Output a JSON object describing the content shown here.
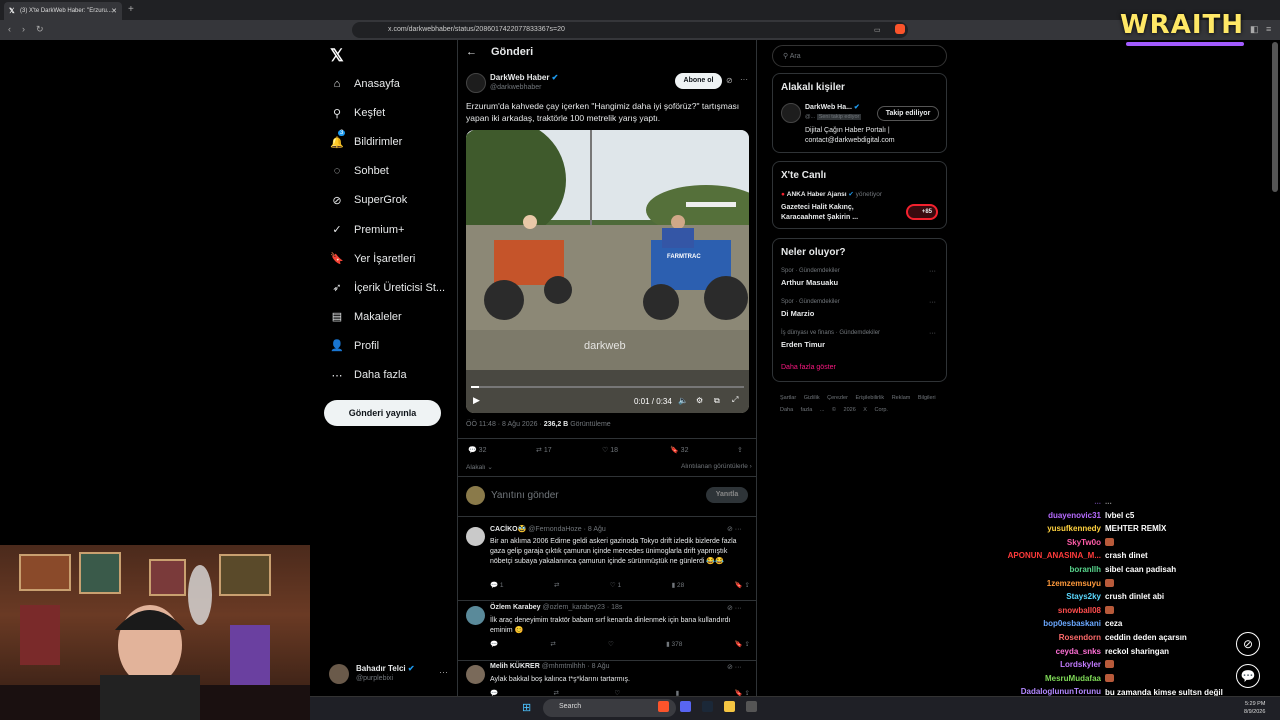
{
  "browser": {
    "tab_title": "(3) X'te DarkWeb Haber: \"Erzuru...",
    "url": "x.com/darkwebhaber/status/2086017422077833367s=20"
  },
  "overlay": {
    "watermark": "WRAITH"
  },
  "nav": {
    "items": [
      {
        "label": "Anasayfa",
        "icon": "home-icon"
      },
      {
        "label": "Keşfet",
        "icon": "search-icon"
      },
      {
        "label": "Bildirimler",
        "icon": "bell-icon",
        "badge": "3"
      },
      {
        "label": "Sohbet",
        "icon": "chat-icon"
      },
      {
        "label": "SuperGrok",
        "icon": "grok-icon"
      },
      {
        "label": "Premium+",
        "icon": "premium-icon"
      },
      {
        "label": "Yer İşaretleri",
        "icon": "bookmark-icon"
      },
      {
        "label": "İçerik Üreticisi St...",
        "icon": "rocket-icon"
      },
      {
        "label": "Makaleler",
        "icon": "article-icon"
      },
      {
        "label": "Profil",
        "icon": "person-icon"
      },
      {
        "label": "Daha fazla",
        "icon": "more-icon"
      }
    ],
    "post_button": "Gönderi yayınla",
    "user": {
      "name": "Bahadır Telci",
      "handle": "@purplebixi"
    }
  },
  "post": {
    "header": "Gönderi",
    "author": {
      "name": "DarkWeb Haber",
      "handle": "@darkwebhaber"
    },
    "subscribe": "Abone ol",
    "text": "Erzurum'da kahvede çay içerken \"Hangimiz daha iyi şoförüz?\" tartışması yapan iki arkadaş, traktörle 100 metrelik yarış yaptı.",
    "video": {
      "time": "0:01 / 0:34",
      "progress": 0.03,
      "watermark": "darkweb",
      "tractor_label": "FARMTRAC"
    },
    "meta": {
      "time": "ÖÖ 11:48 · 8 Ağu 2026 ·",
      "views": "236,2 B",
      "views_label": "Görüntüleme"
    },
    "actions": {
      "replies": "32",
      "reposts": "17",
      "likes": "18",
      "bookmarks": "32"
    },
    "relevant": "Alakalı",
    "engagements": "Alıntılanan görüntülerle",
    "reply_placeholder": "Yanıtını gönder",
    "reply_button": "Yanıtla"
  },
  "comments": [
    {
      "name": "CACİKO🥸",
      "handle": "@FernondaHoze · 8 Ağu",
      "text": "Bir an aklıma 2006 Edirne geldi askeri gazinoda Tokyo drift izledik bizlerde fazla gaza gelip garaja çıktık çamurun içinde  mercedes ünimoglarla drift yapmıştık nöbetçi subaya yakalanınca çamurun içinde sürünmüştük ne günlerdi 😂😂",
      "replies": "1",
      "reposts": "",
      "likes": "1",
      "views": "28",
      "avatar": "#c9c9c9"
    },
    {
      "name": "Özlem Karabey",
      "handle": "@ozlem_karabey23 · 18s",
      "text": "İlk araç deneyimim traktör babam sırf kenarda dinlenmek için bana kullandırdı eminim 😊",
      "replies": "",
      "reposts": "",
      "likes": "",
      "views": "378",
      "avatar": "#5a8a9a"
    },
    {
      "name": "Melih KÜKRER",
      "handle": "@mhmtmlhhh · 8 Ağu",
      "text": "Aylak bakkal boş kalınca t*ş*klarını tartarmış.",
      "replies": "",
      "reposts": "",
      "likes": "",
      "views": "",
      "avatar": "#7a6a5a"
    }
  ],
  "right": {
    "search_placeholder": "Ara",
    "relevant_title": "Alakalı kişiler",
    "relevant_person": {
      "name": "DarkWeb Ha...",
      "handle": "@...",
      "badge": "Seni takip ediyor",
      "follow": "Takip ediliyor",
      "bio": "Dijital Çağın Haber Portalı | contact@darkwebdigital.com"
    },
    "live_title": "X'te Canlı",
    "live": {
      "account": "ANKA Haber Ajansı",
      "role": "yönetiyor",
      "title": "Gazeteci Halit Kakınç, Karacaahmet Şakirin ...",
      "count": "+85"
    },
    "trends_title": "Neler oluyor?",
    "trends": [
      {
        "meta": "Spor · Gündemdekiler",
        "name": "Arthur Masuaku"
      },
      {
        "meta": "Spor · Gündemdekiler",
        "name": "Di Marzio"
      },
      {
        "meta": "İş dünyası ve finans · Gündemdekiler",
        "name": "Erden Timur"
      }
    ],
    "show_more": "Daha fazla göster",
    "footer": "Şartlar Gizlilik Çerezler Erişilebilirlik Reklam Bilgileri Daha fazla ... © 2026 X Corp."
  },
  "chat": [
    {
      "user": "...",
      "msg": "...",
      "color": "#a970ff"
    },
    {
      "user": "duayenovic31",
      "msg": "lvbel c5",
      "color": "#b76bff"
    },
    {
      "user": "yusufkennedy",
      "msg": "MEHTER REMİX",
      "color": "#ffd23f"
    },
    {
      "user": "SkyTw0o",
      "msg": "",
      "color": "#ff5ca8",
      "emote": true
    },
    {
      "user": "APONUN_ANASINA_M...",
      "msg": "crash dinet",
      "color": "#ff3b3b"
    },
    {
      "user": "boranllh",
      "msg": "sibel caan padisah",
      "color": "#58d68d"
    },
    {
      "user": "1zemzemsuyu",
      "msg": "",
      "color": "#ff9a3c",
      "emote": true
    },
    {
      "user": "Stays2ky",
      "msg": "crush dinlet abi",
      "color": "#5bd9ff"
    },
    {
      "user": "snowball08",
      "msg": "",
      "color": "#ff4d4d",
      "emote": true
    },
    {
      "user": "bop0esbaskani",
      "msg": "ceza",
      "color": "#6aa8ff"
    },
    {
      "user": "Rosendorn",
      "msg": "ceddin deden açarsın",
      "color": "#ff6b6b"
    },
    {
      "user": "ceyda_snks",
      "msg": "reckol sharingan",
      "color": "#ff70d6"
    },
    {
      "user": "Lordskyler",
      "msg": "",
      "color": "#c27bff",
      "emote": true
    },
    {
      "user": "MesruMudafaa",
      "msg": "",
      "color": "#7ed957",
      "emote": true
    },
    {
      "user": "DadaloglununTorunu",
      "msg": "bu zamanda kimse sultsn değil hükümdar değil padişah değil",
      "color": "#b388ff"
    }
  ],
  "taskbar": {
    "search": "Search",
    "time": "5:29 PM",
    "date": "8/9/2026"
  }
}
